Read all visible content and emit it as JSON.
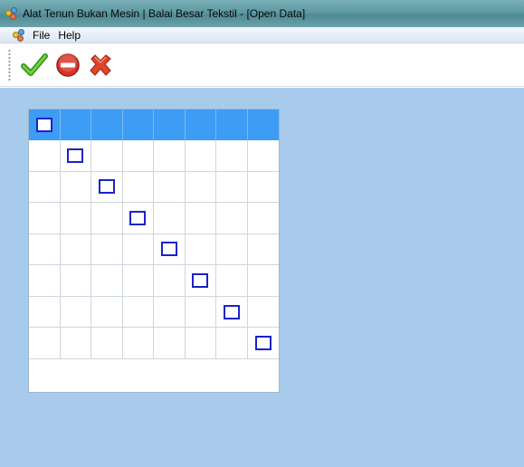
{
  "window": {
    "title": "Alat Tenun Bukan Mesin | Balai Besar Tekstil - [Open Data]",
    "icon": "app-molecule-icon"
  },
  "menubar": {
    "icon": "app-molecule-icon",
    "items": [
      {
        "label": "File"
      },
      {
        "label": "Help"
      }
    ]
  },
  "toolbar": {
    "buttons": [
      {
        "icon": "checkmark-icon",
        "color": "#3aa61e"
      },
      {
        "icon": "no-entry-icon",
        "color": "#d8332a"
      },
      {
        "icon": "red-x-icon",
        "color": "#e0452a"
      }
    ]
  },
  "workspace": {
    "background": "#a8cbec"
  },
  "grid": {
    "rows": 8,
    "columns": 8,
    "header_color": "#3d9cf4",
    "checkbox_color": "#1a24c8",
    "checked_cells": [
      [
        0,
        0
      ],
      [
        1,
        1
      ],
      [
        2,
        2
      ],
      [
        3,
        3
      ],
      [
        4,
        4
      ],
      [
        5,
        5
      ],
      [
        6,
        6
      ],
      [
        7,
        7
      ]
    ]
  }
}
